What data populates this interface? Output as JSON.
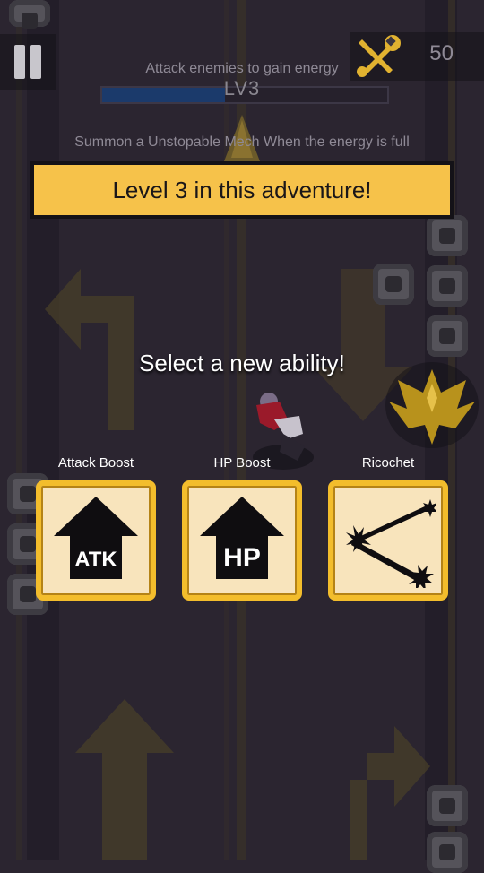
{
  "hud": {
    "energy_hint": "Attack enemies to gain energy",
    "level_label": "LV3",
    "energy_level": 0.43,
    "summon_hint": "Summon a Unstopable Mech When the energy is full",
    "score": "50"
  },
  "banner": {
    "text": "Level 3 in this adventure!"
  },
  "prompt": {
    "text": "Select a new ability!"
  },
  "abilities": [
    {
      "label": "Attack Boost",
      "icon_text": "ATK",
      "icon": "up-arrow-icon"
    },
    {
      "label": "HP Boost",
      "icon_text": "HP",
      "icon": "up-arrow-icon"
    },
    {
      "label": "Ricochet",
      "icon": "ricochet-icon"
    }
  ],
  "colors": {
    "banner": "#f6c24a",
    "card_border": "#f3bd2c",
    "card_bg": "#f8e4bc",
    "energy_fill": "#1b3a6b"
  }
}
